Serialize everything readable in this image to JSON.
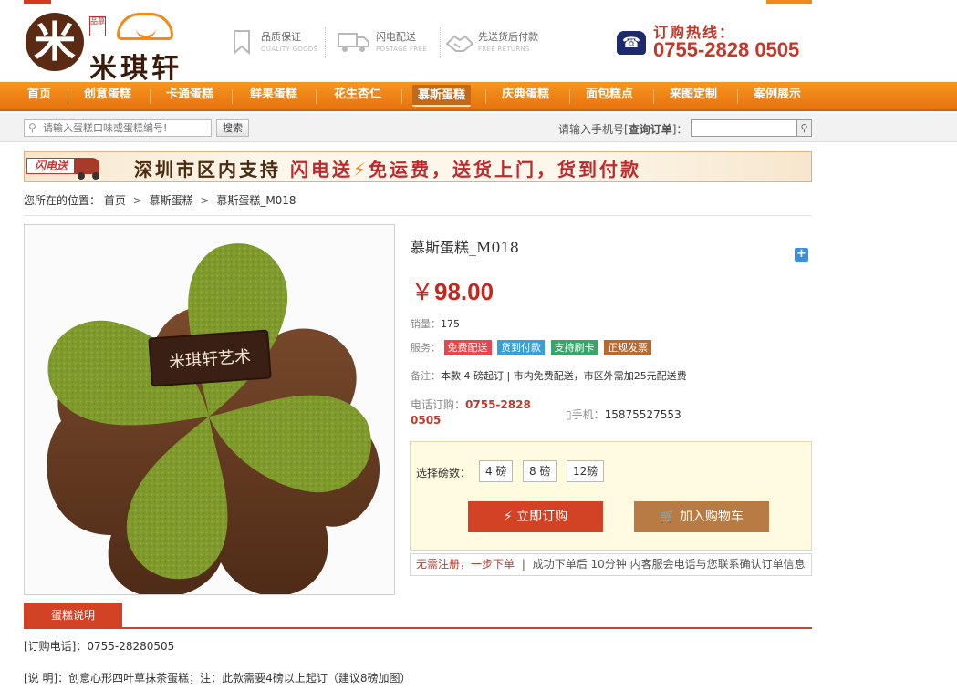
{
  "header": {
    "logo_mark": "米",
    "logo_seal": "品慕",
    "logo_text": "米琪轩",
    "services": [
      {
        "title": "品质保证",
        "sub": "QUALITY GOODS",
        "icon": "bookmark-icon"
      },
      {
        "title": "闪电配送",
        "sub": "POSTAGE FREE",
        "icon": "truck-icon"
      },
      {
        "title": "先送货后付款",
        "sub": "FREE RETURNS",
        "icon": "handshake-icon"
      }
    ],
    "hotline_label": "订购热线：",
    "hotline_number": "0755-2828 0505"
  },
  "nav": {
    "items": [
      "首页",
      "创意蛋糕",
      "卡通蛋糕",
      "鲜果蛋糕",
      "花生杏仁",
      "慕斯蛋糕",
      "庆典蛋糕",
      "面包糕点",
      "来图定制",
      "案例展示"
    ],
    "active": "慕斯蛋糕"
  },
  "search": {
    "placeholder": "请输入蛋糕口味或蛋糕编号!",
    "button": "搜索",
    "order_label_pre": "请输入手机号[",
    "order_label_bold": "查询订单",
    "order_label_post": "]："
  },
  "banner": {
    "tag": "闪电送",
    "text_a": "深圳市区内支持",
    "text_b": "闪电送",
    "text_c": "免运费，送货上门，货到付款"
  },
  "breadcrumb": {
    "prefix": "您所在的位置：",
    "items": [
      "首页",
      "慕斯蛋糕",
      "慕斯蛋糕_M018"
    ]
  },
  "product": {
    "title": "慕斯蛋糕_M018",
    "currency": "￥",
    "price": "98.00",
    "sales_label": "销量：",
    "sales": "175",
    "services_label": "服务：",
    "badges": [
      {
        "label": "免费配送",
        "color": "#e8464a"
      },
      {
        "label": "货到付款",
        "color": "#3a9fd6"
      },
      {
        "label": "支持刷卡",
        "color": "#3aa56a"
      },
      {
        "label": "正规发票",
        "color": "#b8692e"
      }
    ],
    "note_label": "备注：",
    "note": "本款 4 磅起订 | 市内免费配送，市区外需加25元配送费",
    "tel_label": "电话订购：",
    "tel": "0755-2828 0505",
    "mobile_label": "手机：",
    "mobile": "15875527553",
    "plaque_text": "米琪轩艺术",
    "size_label": "选择磅数：",
    "sizes": [
      "4 磅",
      "8 磅",
      "12磅"
    ],
    "buy_now": "立即订购",
    "add_cart": "加入购物车",
    "quick_red": "无需注册，一步下单",
    "quick_text": "成功下单后 10分钟 内客服会电话与您联系确认订单信息"
  },
  "description": {
    "tab": "蛋糕说明",
    "tel_line": "[订购电话]：0755-28280505",
    "text_line": "[说  明]：创意心形四叶草抹茶蛋糕；注：此款需要4磅以上起订（建议8磅加图）"
  },
  "colors": {
    "brand_orange": "#f08a1a",
    "price_red": "#c0291f",
    "button_red": "#d44226",
    "button_brown": "#b87b44"
  }
}
